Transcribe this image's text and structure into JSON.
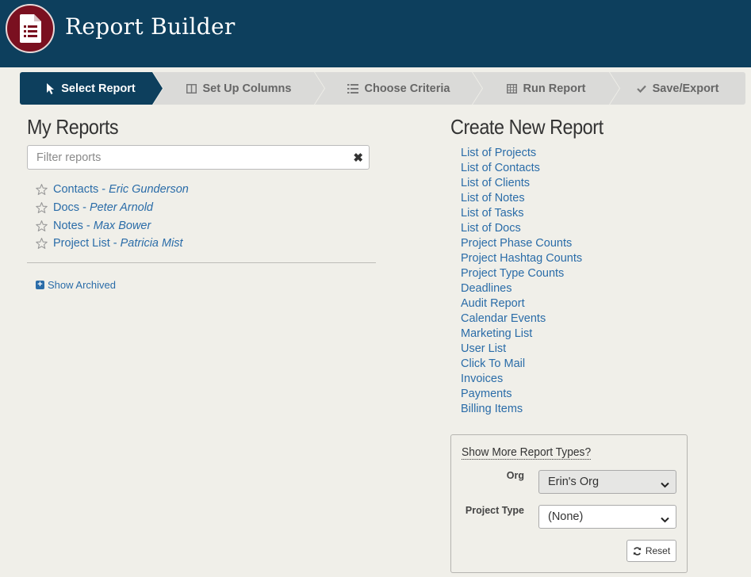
{
  "app": {
    "title": "Report Builder"
  },
  "steps": [
    {
      "label": "Select Report",
      "icon": "cursor-icon",
      "active": true
    },
    {
      "label": "Set Up Columns",
      "icon": "columns-icon",
      "active": false
    },
    {
      "label": "Choose Criteria",
      "icon": "list-icon",
      "active": false
    },
    {
      "label": "Run Report",
      "icon": "table-icon",
      "active": false
    },
    {
      "label": "Save/Export",
      "icon": "check-icon",
      "active": false
    }
  ],
  "my_reports": {
    "title": "My Reports",
    "filter_placeholder": "Filter reports",
    "filter_value": "",
    "items": [
      {
        "name": "Contacts",
        "owner": "Eric Gunderson"
      },
      {
        "name": "Docs",
        "owner": "Peter Arnold"
      },
      {
        "name": "Notes",
        "owner": "Max Bower"
      },
      {
        "name": "Project List",
        "owner": "Patricia Mist"
      }
    ],
    "separator": " - ",
    "show_archived": "Show Archived"
  },
  "create_new": {
    "title": "Create New Report",
    "items": [
      "List of Projects",
      "List of Contacts",
      "List of Clients",
      "List of Notes",
      "List of Tasks",
      "List of Docs",
      "Project Phase Counts",
      "Project Hashtag Counts",
      "Project Type Counts",
      "Deadlines",
      "Audit Report",
      "Calendar Events",
      "Marketing List",
      "User List",
      "Click To Mail",
      "Invoices",
      "Payments",
      "Billing Items"
    ]
  },
  "more_types": {
    "title": "Show More Report Types?",
    "org_label": "Org",
    "org_value": "Erin's Org",
    "project_type_label": "Project Type",
    "project_type_value": "(None)",
    "reset_label": "Reset"
  },
  "colors": {
    "header_bg": "#0d3f5d",
    "logo_bg": "#7a1020",
    "link": "#2a6ca8",
    "page_bg": "#f0efe9"
  }
}
